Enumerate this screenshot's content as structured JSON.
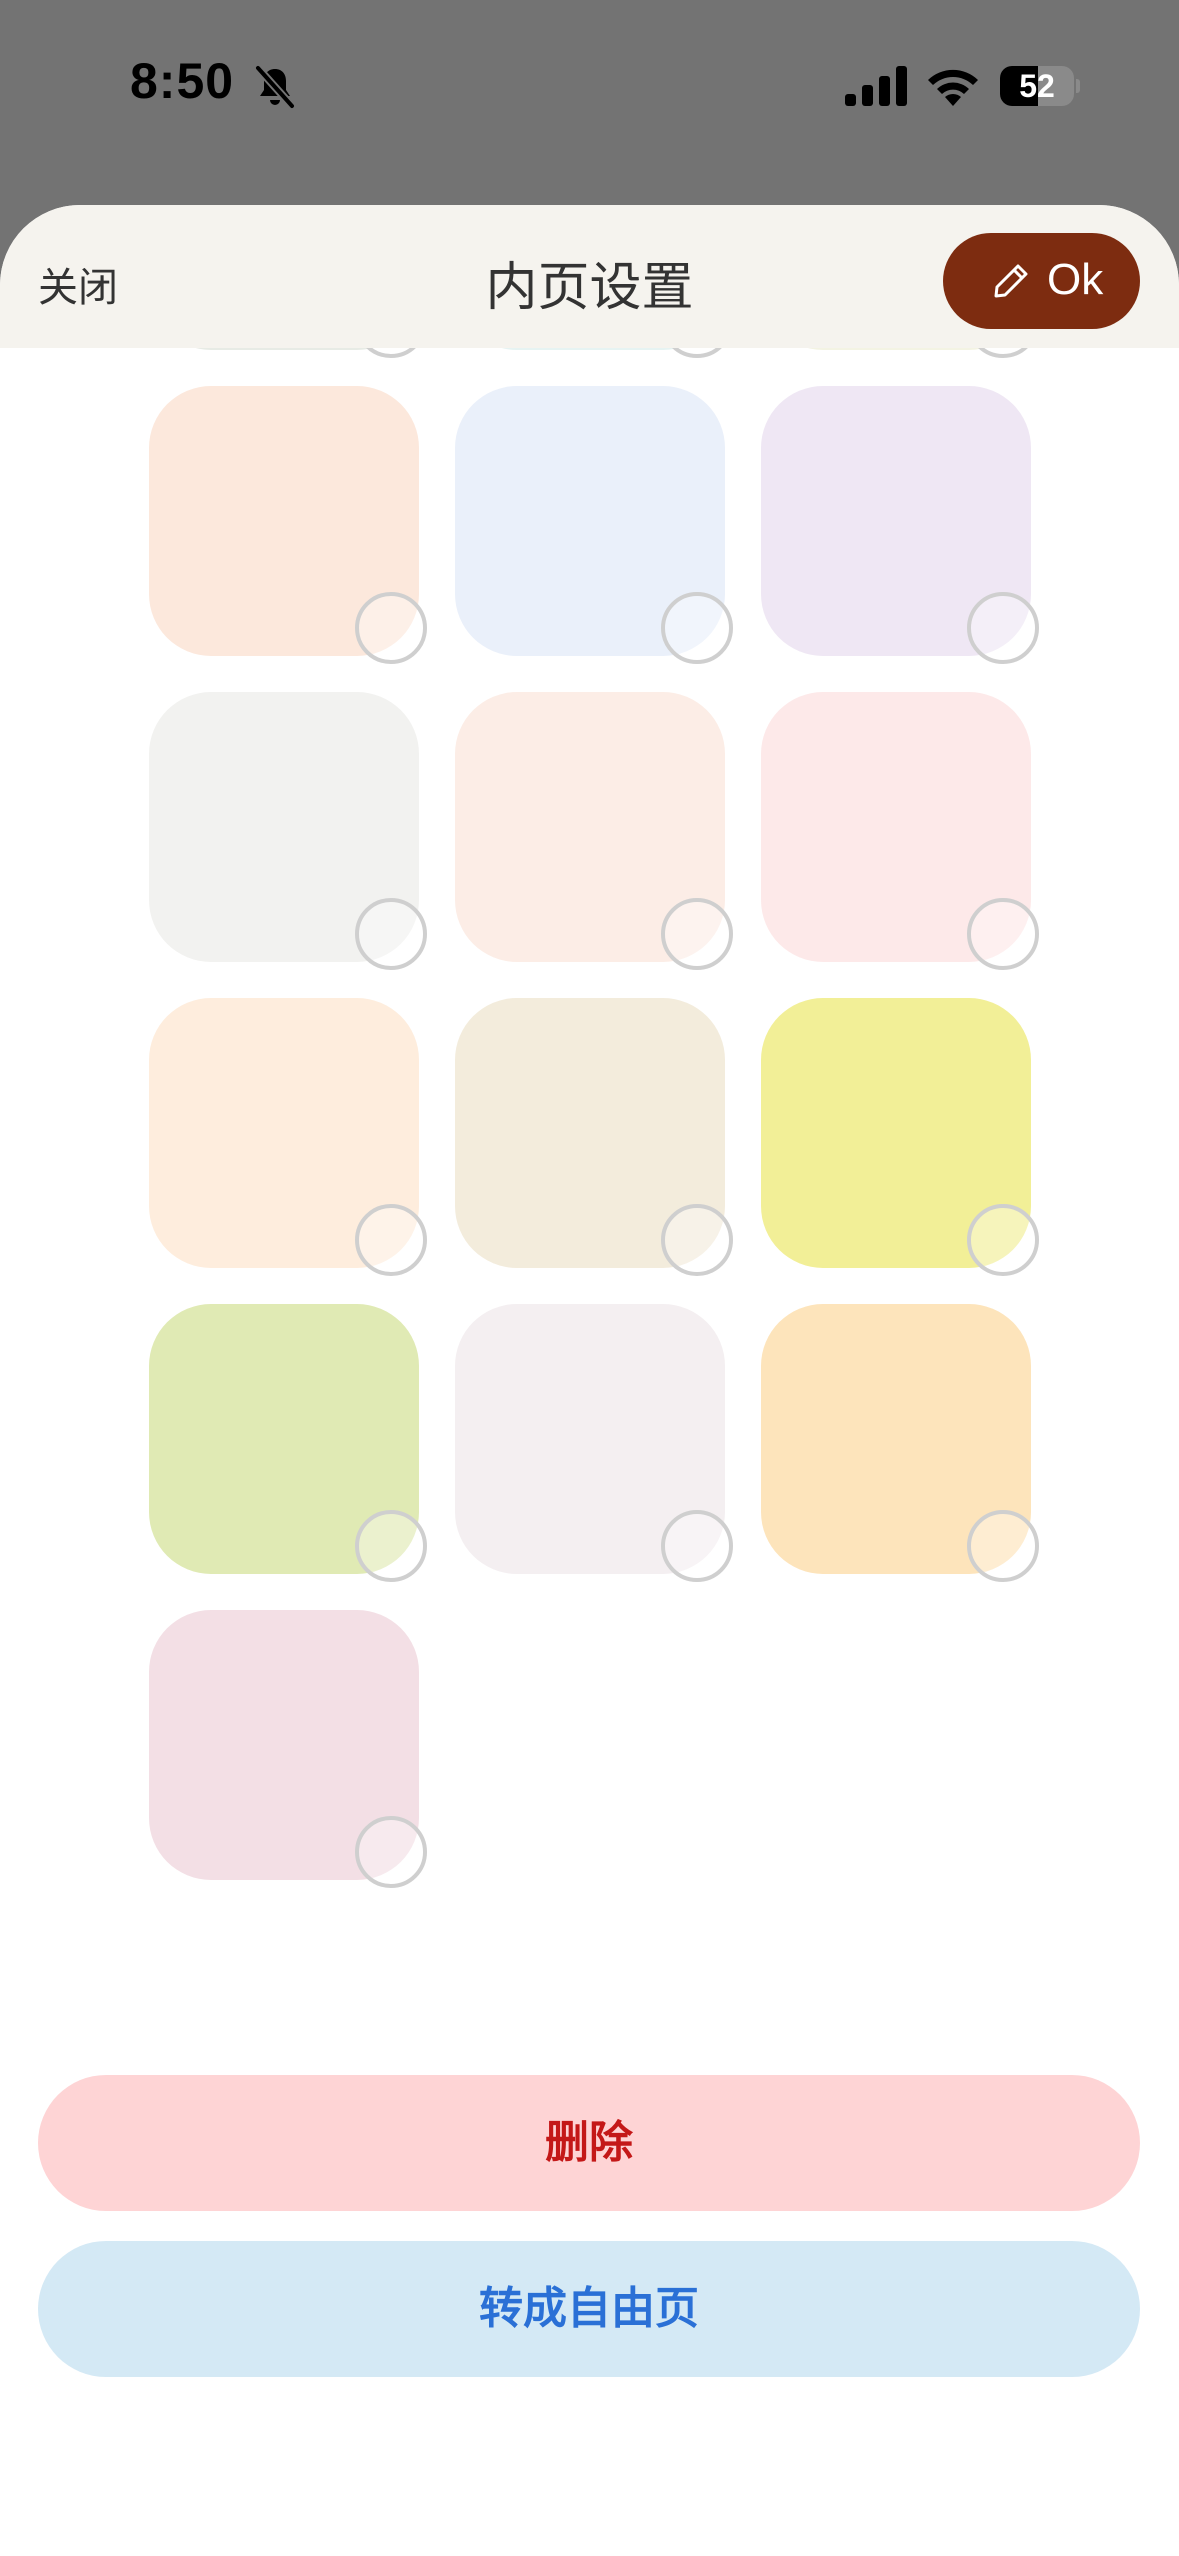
{
  "status_bar": {
    "time": "8:50",
    "battery_level": "52",
    "battery_fraction": 0.52,
    "icons": [
      "bell-slash-icon",
      "cellular-signal-icon",
      "wifi-icon",
      "battery-icon"
    ]
  },
  "header": {
    "close_label": "关闭",
    "title": "内页设置",
    "ok_label": "Ok",
    "ok_icon": "pencil-icon",
    "ok_color": "#7d2c10"
  },
  "swatches": [
    {
      "color": "#e7ebe5",
      "selected": false
    },
    {
      "color": "#e6f3f2",
      "selected": false
    },
    {
      "color": "#f3f3e3",
      "selected": false
    },
    {
      "color": "#fce8dc",
      "selected": false
    },
    {
      "color": "#eaf0fa",
      "selected": false
    },
    {
      "color": "#efe7f4",
      "selected": false
    },
    {
      "color": "#f2f2f0",
      "selected": false
    },
    {
      "color": "#fcede6",
      "selected": false
    },
    {
      "color": "#fde9e9",
      "selected": false
    },
    {
      "color": "#feeddd",
      "selected": false
    },
    {
      "color": "#f3ecdc",
      "selected": false
    },
    {
      "color": "#f2ef97",
      "selected": false
    },
    {
      "color": "#e0eab4",
      "selected": false
    },
    {
      "color": "#f4eff1",
      "selected": false
    },
    {
      "color": "#fde4bb",
      "selected": false
    },
    {
      "color": "#f3dfe5",
      "selected": false
    }
  ],
  "actions": {
    "delete_label": "删除",
    "delete_color": "#fed4d5",
    "convert_label": "转成自由页",
    "convert_color": "#d4e9f5"
  }
}
